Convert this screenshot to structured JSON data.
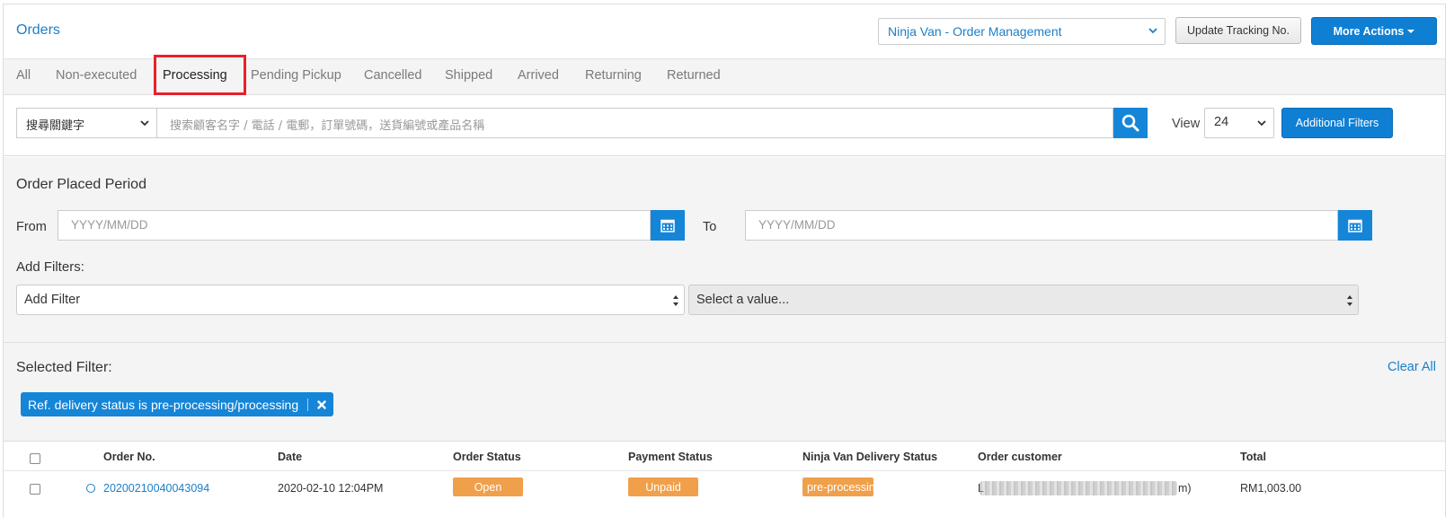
{
  "header": {
    "title": "Orders",
    "channel_select": "Ninja Van - Order Management",
    "update_tracking_label": "Update Tracking No.",
    "more_actions_label": "More Actions"
  },
  "tabs": [
    {
      "label": "All"
    },
    {
      "label": "Non-executed"
    },
    {
      "label": "Processing"
    },
    {
      "label": "Pending Pickup"
    },
    {
      "label": "Cancelled"
    },
    {
      "label": "Shipped"
    },
    {
      "label": "Arrived"
    },
    {
      "label": "Returning"
    },
    {
      "label": "Returned"
    }
  ],
  "active_tab": "Processing",
  "search": {
    "keyword_select": "搜尋關鍵字",
    "placeholder": "搜索顧客名字 / 電話 / 電郵，訂單號碼，送貨編號或產品名稱",
    "view_label": "View",
    "view_value": "24",
    "additional_filters_label": "Additional Filters"
  },
  "period": {
    "title": "Order Placed Period",
    "from_label": "From",
    "to_label": "To",
    "from_placeholder": "YYYY/MM/DD",
    "to_placeholder": "YYYY/MM/DD"
  },
  "add_filters": {
    "title": "Add Filters:",
    "filter_select": "Add Filter",
    "value_select": "Select a value..."
  },
  "selected_filter": {
    "title": "Selected Filter:",
    "clear_all": "Clear All",
    "chip": "Ref. delivery status is pre-processing/processing"
  },
  "table": {
    "columns": [
      "Order No.",
      "Date",
      "Order Status",
      "Payment Status",
      "Ninja Van Delivery Status",
      "Order customer",
      "Total"
    ],
    "rows": [
      {
        "order_no": "20200210040043094",
        "date": "2020-02-10 12:04PM",
        "order_status": "Open",
        "payment_status": "Unpaid",
        "delivery_status": "pre-processin",
        "customer_start": "L",
        "customer_end": "m)",
        "total": "RM1,003.00"
      }
    ]
  },
  "colors": {
    "accent": "#0f7fd4",
    "link": "#1a7fc9",
    "badge": "#f0a04b",
    "highlight": "#e8202a"
  }
}
